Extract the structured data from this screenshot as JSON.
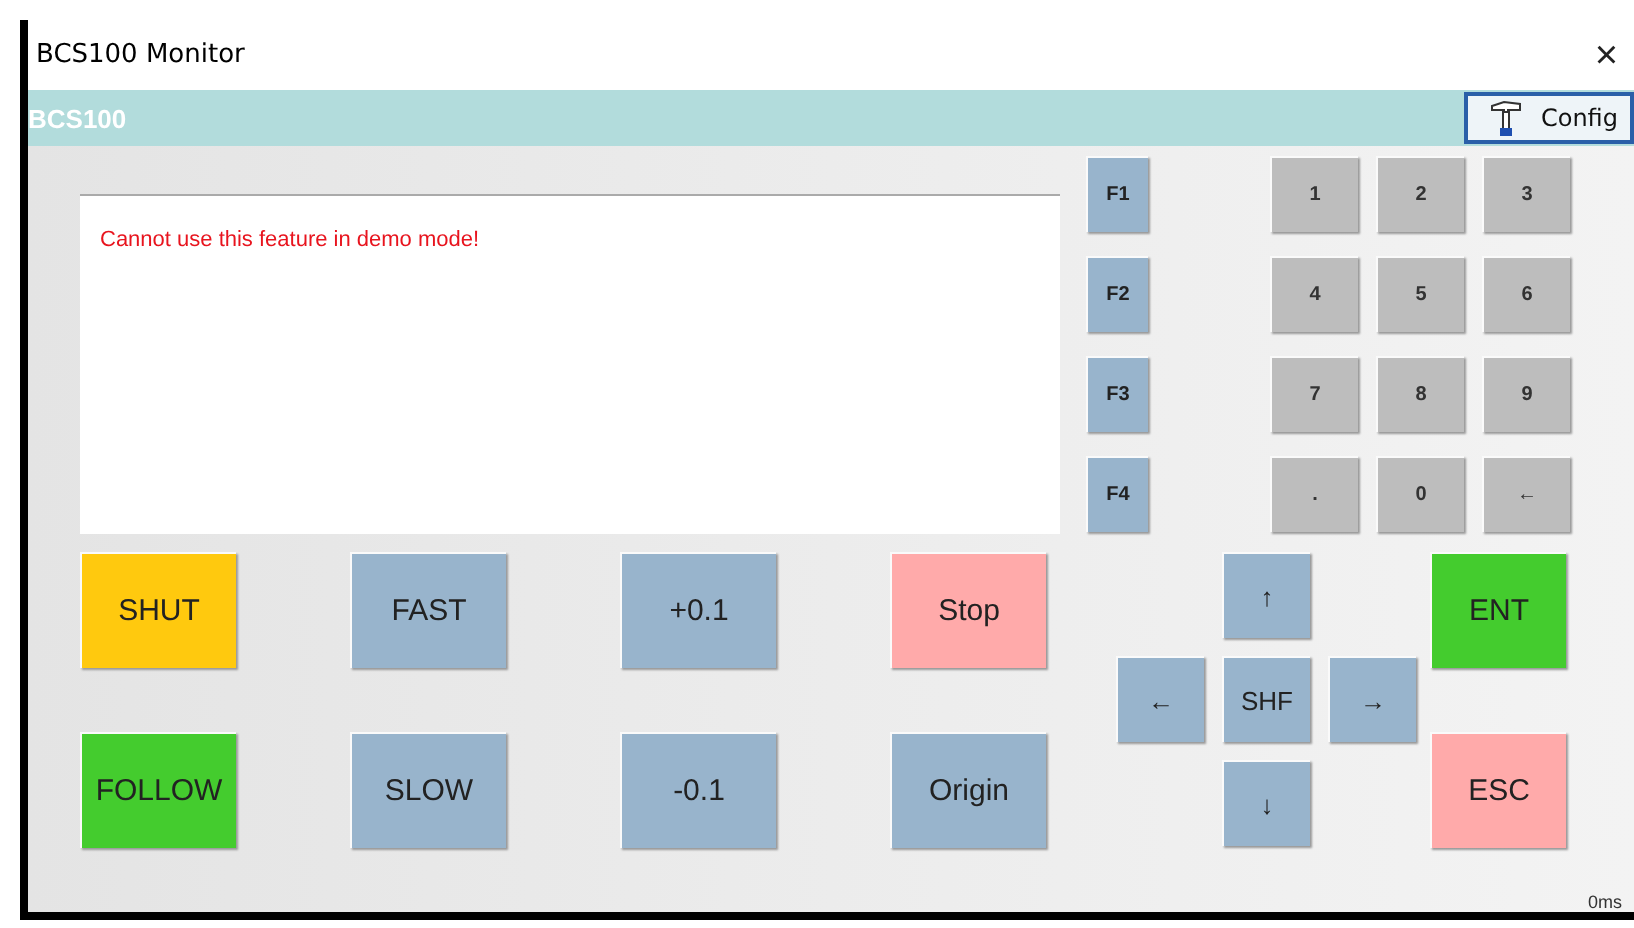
{
  "window": {
    "title": "BCS100 Monitor",
    "close": "×"
  },
  "header": {
    "title": "BCS100",
    "config_button": "Config"
  },
  "display": {
    "message": "Cannot use this feature in demo mode!"
  },
  "function_keys": [
    "F1",
    "F2",
    "F3",
    "F4"
  ],
  "numpad": [
    "1",
    "2",
    "3",
    "4",
    "5",
    "6",
    "7",
    "8",
    "9",
    ".",
    "0",
    "←"
  ],
  "control_buttons": [
    {
      "label": "SHUT",
      "color": "#ffc90e"
    },
    {
      "label": "FAST",
      "color": "#98b4cc"
    },
    {
      "label": "+0.1",
      "color": "#98b4cc"
    },
    {
      "label": "Stop",
      "color": "#ffaaaa"
    },
    {
      "label": "FOLLOW",
      "color": "#44cc2e"
    },
    {
      "label": "SLOW",
      "color": "#98b4cc"
    },
    {
      "label": "-0.1",
      "color": "#98b4cc"
    },
    {
      "label": "Origin",
      "color": "#98b4cc"
    }
  ],
  "navigation": [
    "↑",
    "←",
    "SHF",
    "→",
    "↓"
  ],
  "action_keys": [
    {
      "label": "ENT",
      "color": "#44cc2e"
    },
    {
      "label": "ESC",
      "color": "#ffaaaa"
    }
  ],
  "status": "0ms"
}
